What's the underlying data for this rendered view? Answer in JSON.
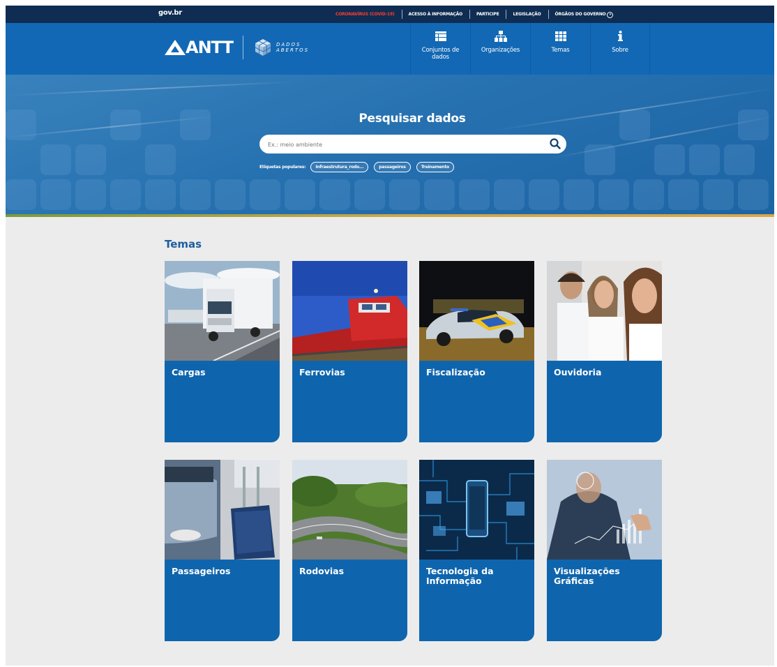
{
  "govbar": {
    "brand": "gov.br",
    "links": [
      "CORONAVÍRUS (COVID-19)",
      "ACESSO À INFORMAÇÃO",
      "PARTICIPE",
      "LEGISLAÇÃO",
      "ÓRGÃOS DO GOVERNO"
    ],
    "covid_color": "#ff3b30"
  },
  "header": {
    "logo_text": "ANTT",
    "dados_line1": "DADOS",
    "dados_line2": "ABERTOS",
    "nav": [
      {
        "label": "Conjuntos de dados",
        "icon": "table-icon"
      },
      {
        "label": "Organizações",
        "icon": "org-chart-icon"
      },
      {
        "label": "Temas",
        "icon": "grid-icon"
      },
      {
        "label": "Sobre",
        "icon": "info-icon"
      }
    ]
  },
  "hero": {
    "title": "Pesquisar dados",
    "search_placeholder": "Ex.: meio ambiente",
    "tags_label": "Etiquetas populares:",
    "tags": [
      "Infraestrutura_rodo...",
      "passageiros",
      "Treinamento"
    ]
  },
  "main": {
    "title": "Temas",
    "themes": [
      {
        "name": "Cargas"
      },
      {
        "name": "Ferrovias"
      },
      {
        "name": "Fiscalização"
      },
      {
        "name": "Ouvidoria"
      },
      {
        "name": "Passageiros"
      },
      {
        "name": "Rodovias"
      },
      {
        "name": "Tecnologia da Informação"
      },
      {
        "name": "Visualizações Gráficas"
      }
    ]
  },
  "colors": {
    "govbar": "#0f2d52",
    "header": "#1268b4",
    "card": "#0f65ad",
    "section_title": "#1d5e9e"
  }
}
